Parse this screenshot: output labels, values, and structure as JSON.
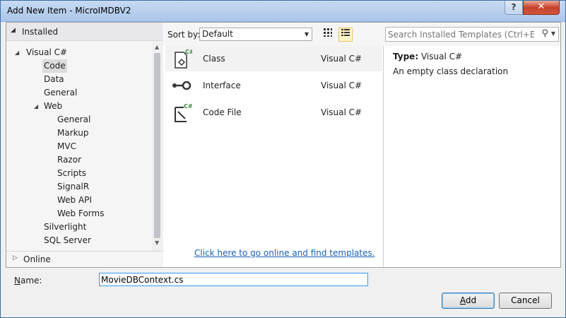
{
  "window": {
    "title": "Add New Item - MicroIMDBV2",
    "help_label": "?",
    "close_label": "✕"
  },
  "tree": {
    "installed_label": "Installed",
    "online_label": "Online",
    "items": [
      {
        "label": "Visual C#",
        "level": 0,
        "expanded": true
      },
      {
        "label": "Code",
        "level": 1,
        "selected": true
      },
      {
        "label": "Data",
        "level": 1
      },
      {
        "label": "General",
        "level": 1
      },
      {
        "label": "Web",
        "level": 1,
        "expanded": true
      },
      {
        "label": "General",
        "level": 2
      },
      {
        "label": "Markup",
        "level": 2
      },
      {
        "label": "MVC",
        "level": 2
      },
      {
        "label": "Razor",
        "level": 2
      },
      {
        "label": "Scripts",
        "level": 2
      },
      {
        "label": "SignalR",
        "level": 2
      },
      {
        "label": "Web API",
        "level": 2
      },
      {
        "label": "Web Forms",
        "level": 2
      },
      {
        "label": "Silverlight",
        "level": 1
      },
      {
        "label": "SQL Server",
        "level": 1
      }
    ]
  },
  "toolbar": {
    "sort_by_label": "Sort by:",
    "sort_value": "Default",
    "search_placeholder": "Search Installed Templates (Ctrl+E)"
  },
  "templates": [
    {
      "name": "Class",
      "language": "Visual C#",
      "icon": "class-icon",
      "selected": true
    },
    {
      "name": "Interface",
      "language": "Visual C#",
      "icon": "interface-icon"
    },
    {
      "name": "Code File",
      "language": "Visual C#",
      "icon": "code-file-icon"
    }
  ],
  "online_link": "Click here to go online and find templates.",
  "detail": {
    "type_label": "Type:",
    "type_value": "Visual C#",
    "description": "An empty class declaration"
  },
  "bottom": {
    "name_label_prefix": "N",
    "name_label_rest": "ame:",
    "name_value": "MovieDBContext.cs",
    "add_label_u": "A",
    "add_label_rest": "dd",
    "cancel_label": "Cancel"
  }
}
